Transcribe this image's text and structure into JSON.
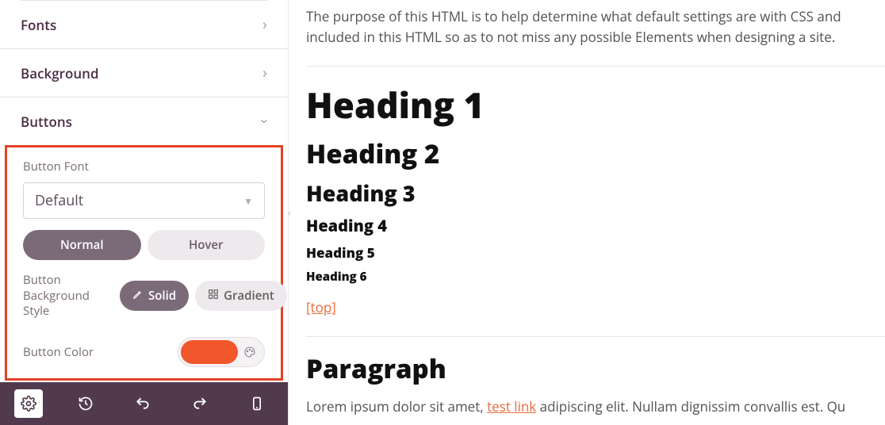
{
  "sidebar": {
    "sections": [
      {
        "label": "Fonts",
        "expanded": false
      },
      {
        "label": "Background",
        "expanded": false
      },
      {
        "label": "Buttons",
        "expanded": true
      }
    ],
    "buttons_panel": {
      "font_label": "Button Font",
      "font_value": "Default",
      "tabs": {
        "normal": "Normal",
        "hover": "Hover"
      },
      "bg_style_label": "Button Background Style",
      "bg_style": {
        "solid": "Solid",
        "gradient": "Gradient"
      },
      "color_label": "Button Color",
      "color_value": "#f1572a"
    }
  },
  "preview": {
    "intro": "The purpose of this HTML is to help determine what default settings are with CSS and included in this HTML so as to not miss any possible Elements when designing a site.",
    "h1": "Heading 1",
    "h2": "Heading 2",
    "h3": "Heading 3",
    "h4": "Heading 4",
    "h5": "Heading 5",
    "h6": "Heading 6",
    "top_link": "[top]",
    "paragraph_heading": "Paragraph",
    "lorem_a": "Lorem ipsum dolor sit amet, ",
    "lorem_link": "test link",
    "lorem_b": " adipiscing elit. Nullam dignissim convallis est. Qu"
  }
}
